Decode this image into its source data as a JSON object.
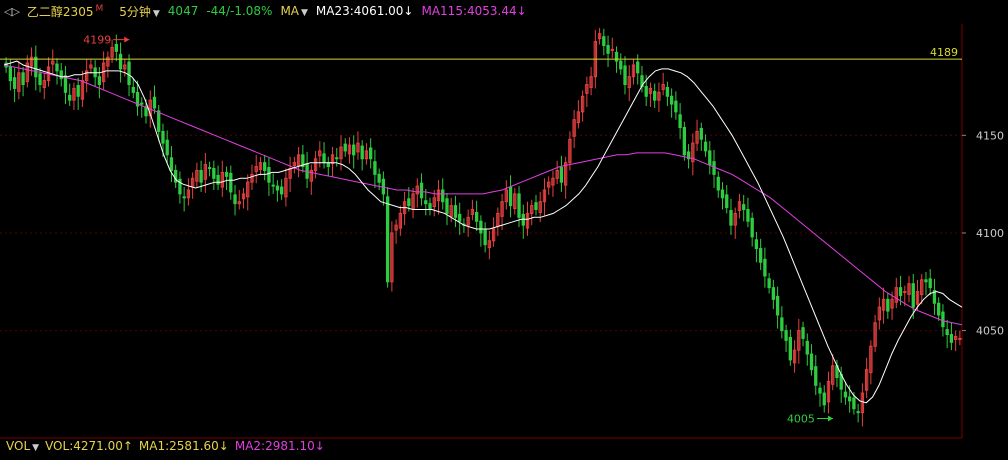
{
  "header": {
    "nav_icons": "◁▷",
    "symbol": "乙二醇2305",
    "symbol_flag": "M",
    "period": "5分钟",
    "last_price": "4047",
    "change": "-44/-1.08%",
    "ma_button": "MA",
    "ma23_text": "MA23:4061.00↓",
    "ma115_text": "MA115:4053.44↓"
  },
  "volume_bar": {
    "label": "VOL",
    "vol_text": "VOL:4271.00↑",
    "ma1_text": "MA1:2581.60↓",
    "ma2_text": "MA2:2981.10↓"
  },
  "colors": {
    "background": "#000000",
    "up": "#e84040",
    "down": "#2ecc40",
    "ma23": "#ffffff",
    "ma115": "#e040e0",
    "reference_line": "#d8d830",
    "grid": "#5a0000"
  },
  "chart_data": {
    "type": "line",
    "subtype": "candlestick",
    "title": "",
    "ylim": [
      3995,
      4207
    ],
    "y_ticks": [
      4050,
      4100,
      4150
    ],
    "grid": true,
    "reference_line": {
      "value": 4189,
      "label": "4189"
    },
    "annotations": [
      {
        "text": "4199",
        "x": 30,
        "y": 4199,
        "arrow": "right"
      },
      {
        "text": "4005",
        "x": 196,
        "y": 4005,
        "arrow": "right"
      }
    ],
    "close_series": [
      4185,
      4178,
      4174,
      4182,
      4176,
      4187,
      4190,
      4180,
      4176,
      4178,
      4185,
      4188,
      4183,
      4179,
      4172,
      4168,
      4174,
      4170,
      4178,
      4183,
      4186,
      4180,
      4176,
      4187,
      4190,
      4195,
      4193,
      4184,
      4186,
      4176,
      4172,
      4165,
      4166,
      4160,
      4168,
      4164,
      4152,
      4146,
      4140,
      4132,
      4126,
      4120,
      4118,
      4122,
      4128,
      4132,
      4126,
      4135,
      4133,
      4128,
      4125,
      4131,
      4129,
      4121,
      4115,
      4116,
      4120,
      4126,
      4130,
      4134,
      4136,
      4132,
      4126,
      4124,
      4122,
      4120,
      4128,
      4133,
      4136,
      4140,
      4134,
      4128,
      4132,
      4138,
      4142,
      4136,
      4134,
      4140,
      4138,
      4144,
      4142,
      4145,
      4140,
      4146,
      4138,
      4142,
      4138,
      4130,
      4126,
      4120,
      4075,
      4100,
      4104,
      4110,
      4116,
      4114,
      4120,
      4124,
      4118,
      4115,
      4112,
      4118,
      4122,
      4116,
      4110,
      4114,
      4108,
      4106,
      4104,
      4108,
      4112,
      4106,
      4100,
      4094,
      4096,
      4102,
      4110,
      4116,
      4122,
      4114,
      4120,
      4108,
      4104,
      4110,
      4114,
      4112,
      4116,
      4122,
      4126,
      4128,
      4132,
      4126,
      4136,
      4148,
      4158,
      4162,
      4170,
      4176,
      4180,
      4198,
      4202,
      4196,
      4192,
      4194,
      4188,
      4184,
      4176,
      4180,
      4186,
      4182,
      4175,
      4170,
      4174,
      4168,
      4172,
      4176,
      4170,
      4166,
      4162,
      4154,
      4140,
      4138,
      4146,
      4152,
      4148,
      4142,
      4135,
      4130,
      4122,
      4118,
      4113,
      4104,
      4110,
      4116,
      4112,
      4106,
      4098,
      4092,
      4085,
      4078,
      4072,
      4066,
      4058,
      4050,
      4045,
      4035,
      4040,
      4050,
      4046,
      4038,
      4030,
      4022,
      4018,
      4012,
      4024,
      4032,
      4026,
      4020,
      4016,
      4014,
      4010,
      4008,
      4018,
      4030,
      4042,
      4054,
      4062,
      4066,
      4060,
      4066,
      4072,
      4068,
      4070,
      4074,
      4062,
      4070,
      4076,
      4075,
      4072,
      4064,
      4058,
      4052,
      4048,
      4044,
      4047,
      4046
    ],
    "ma23_values": [
      4186,
      4187,
      4188,
      4186,
      4185,
      4184,
      4183,
      4182,
      4181,
      4180,
      4180,
      4181,
      4181,
      4182,
      4182,
      4182,
      4183,
      4183,
      4183,
      4182,
      4180,
      4176,
      4169,
      4160,
      4150,
      4140,
      4132,
      4127,
      4125,
      4124,
      4123,
      4124,
      4125,
      4126,
      4126,
      4127,
      4127,
      4128,
      4128,
      4129,
      4130,
      4130,
      4131,
      4131,
      4132,
      4133,
      4134,
      4135,
      4136,
      4136,
      4136,
      4136,
      4136,
      4135,
      4133,
      4130,
      4126,
      4122,
      4119,
      4116,
      4115,
      4114,
      4113,
      4113,
      4112,
      4112,
      4112,
      4112,
      4111,
      4110,
      4108,
      4106,
      4104,
      4103,
      4102,
      4102,
      4102,
      4103,
      4104,
      4105,
      4106,
      4107,
      4107,
      4108,
      4108,
      4109,
      4110,
      4112,
      4114,
      4117,
      4120,
      4124,
      4129,
      4134,
      4140,
      4146,
      4152,
      4158,
      4164,
      4170,
      4176,
      4180,
      4183,
      4184,
      4184,
      4183,
      4182,
      4180,
      4177,
      4173,
      4169,
      4165,
      4160,
      4155,
      4150,
      4144,
      4138,
      4132,
      4126,
      4119,
      4112,
      4105,
      4098,
      4090,
      4082,
      4074,
      4066,
      4058,
      4050,
      4042,
      4035,
      4028,
      4022,
      4017,
      4014,
      4013,
      4016,
      4022,
      4030,
      4038,
      4045,
      4051,
      4057,
      4062,
      4066,
      4069,
      4070,
      4069,
      4066,
      4064,
      4062
    ],
    "ma115_values": [
      4186,
      4185,
      4184,
      4183,
      4182,
      4181,
      4180,
      4179,
      4178,
      4176,
      4174,
      4172,
      4170,
      4168,
      4166,
      4164,
      4162,
      4160,
      4158,
      4156,
      4154,
      4152,
      4150,
      4148,
      4146,
      4144,
      4142,
      4140,
      4138,
      4136,
      4134,
      4132,
      4131,
      4130,
      4129,
      4128,
      4127,
      4126,
      4125,
      4124,
      4123,
      4122,
      4122,
      4121,
      4121,
      4120,
      4120,
      4120,
      4120,
      4120,
      4120,
      4121,
      4122,
      4124,
      4126,
      4128,
      4130,
      4132,
      4134,
      4135,
      4136,
      4137,
      4138,
      4139,
      4140,
      4140,
      4141,
      4141,
      4141,
      4141,
      4140,
      4139,
      4138,
      4136,
      4134,
      4132,
      4130,
      4127,
      4124,
      4121,
      4118,
      4114,
      4110,
      4106,
      4102,
      4098,
      4094,
      4090,
      4086,
      4082,
      4078,
      4074,
      4070,
      4067,
      4064,
      4061,
      4059,
      4057,
      4055,
      4054,
      4053
    ]
  }
}
